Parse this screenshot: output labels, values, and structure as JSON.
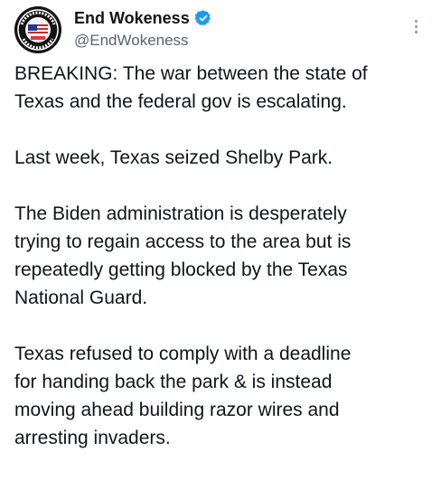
{
  "author": {
    "display_name": "End Wokeness",
    "handle": "@EndWokeness",
    "avatar_icon": "support-badge-logo",
    "avatar_text": "I SUPPORT THE PANINIS TRUCKERS",
    "verified_icon": "verified-badge-icon",
    "verified_color": "#1d9bf0"
  },
  "menu_icon": "more-vertical-icon",
  "paragraphs": [
    "BREAKING: The war between the state of\nTexas and the federal gov is escalating.",
    "Last week, Texas seized Shelby Park.",
    "The Biden administration is desperately\ntrying to regain access to the area but is\nrepeatedly getting blocked by the Texas\nNational Guard.",
    "Texas refused to comply with a deadline\nfor handing back the park & is instead\nmoving ahead building razor wires and\narresting invaders."
  ]
}
